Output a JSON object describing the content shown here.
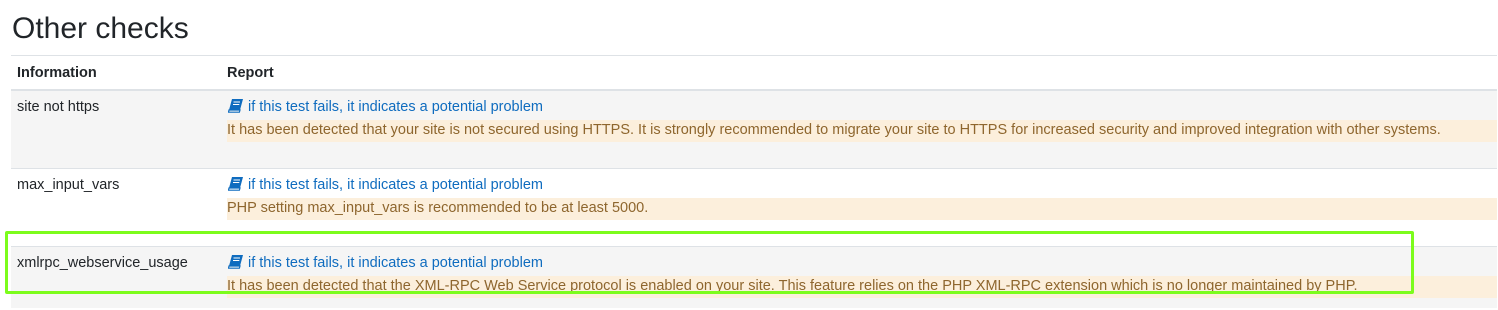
{
  "page": {
    "title": "Other checks"
  },
  "table": {
    "headers": {
      "information": "Information",
      "report": "Report"
    },
    "rows": [
      {
        "information": "site not https",
        "link": "if this test fails, it indicates a potential problem",
        "report": "It has been detected that your site is not secured using HTTPS. It is strongly recommended to migrate your site to HTTPS for increased security and improved integration with other systems."
      },
      {
        "information": "max_input_vars",
        "link": "if this test fails, it indicates a potential problem",
        "report": "PHP setting max_input_vars is recommended to be at least 5000."
      },
      {
        "information": "xmlrpc_webservice_usage",
        "link": "if this test fails, it indicates a potential problem",
        "report": "It has been detected that the XML-RPC Web Service protocol is enabled on your site. This feature relies on the PHP XML-RPC extension which is no longer maintained by PHP."
      }
    ]
  },
  "colors": {
    "link": "#0f6cbf",
    "warning_bg": "#fcefdc",
    "warning_text": "#8e662e",
    "highlight_border": "#7cfc1c"
  },
  "icons": {
    "docs": "book-icon"
  }
}
